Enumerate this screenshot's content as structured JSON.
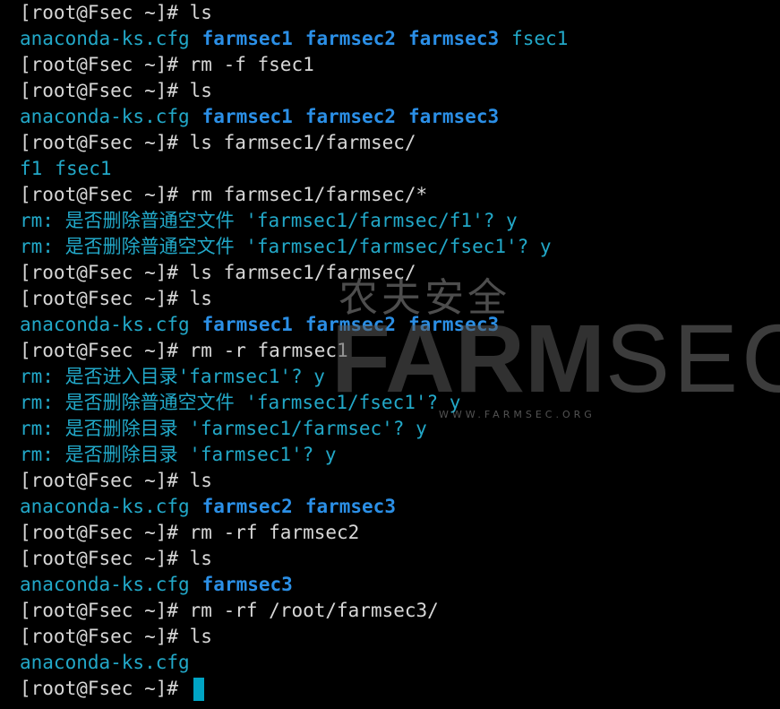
{
  "prompt": "[root@Fsec ~]# ",
  "lines": [
    {
      "type": "prompt",
      "cmd": "ls"
    },
    {
      "type": "listing",
      "items": [
        {
          "name": "anaconda-ks.cfg",
          "kind": "file"
        },
        {
          "name": "farmsec1",
          "kind": "dir"
        },
        {
          "name": "farmsec2",
          "kind": "dir"
        },
        {
          "name": "farmsec3",
          "kind": "dir"
        },
        {
          "name": "fsec1",
          "kind": "file"
        }
      ]
    },
    {
      "type": "prompt",
      "cmd": "rm -f fsec1"
    },
    {
      "type": "prompt",
      "cmd": "ls"
    },
    {
      "type": "listing",
      "items": [
        {
          "name": "anaconda-ks.cfg",
          "kind": "file"
        },
        {
          "name": "farmsec1",
          "kind": "dir"
        },
        {
          "name": "farmsec2",
          "kind": "dir"
        },
        {
          "name": "farmsec3",
          "kind": "dir"
        }
      ]
    },
    {
      "type": "prompt",
      "cmd": "ls farmsec1/farmsec/"
    },
    {
      "type": "listing",
      "items": [
        {
          "name": "f1",
          "kind": "file"
        },
        {
          "name": "fsec1",
          "kind": "file"
        }
      ]
    },
    {
      "type": "prompt",
      "cmd": "rm farmsec1/farmsec/*"
    },
    {
      "type": "output",
      "text": "rm: 是否删除普通空文件 'farmsec1/farmsec/f1'? y"
    },
    {
      "type": "output",
      "text": "rm: 是否删除普通空文件 'farmsec1/farmsec/fsec1'? y"
    },
    {
      "type": "prompt",
      "cmd": "ls farmsec1/farmsec/"
    },
    {
      "type": "prompt",
      "cmd": "ls"
    },
    {
      "type": "listing",
      "items": [
        {
          "name": "anaconda-ks.cfg",
          "kind": "file"
        },
        {
          "name": "farmsec1",
          "kind": "dir"
        },
        {
          "name": "farmsec2",
          "kind": "dir"
        },
        {
          "name": "farmsec3",
          "kind": "dir"
        }
      ]
    },
    {
      "type": "prompt",
      "cmd": "rm -r farmsec1"
    },
    {
      "type": "output",
      "text": "rm: 是否进入目录'farmsec1'? y"
    },
    {
      "type": "output",
      "text": "rm: 是否删除普通空文件 'farmsec1/fsec1'? y"
    },
    {
      "type": "output",
      "text": "rm: 是否删除目录 'farmsec1/farmsec'? y"
    },
    {
      "type": "output",
      "text": "rm: 是否删除目录 'farmsec1'? y"
    },
    {
      "type": "prompt",
      "cmd": "ls"
    },
    {
      "type": "listing",
      "items": [
        {
          "name": "anaconda-ks.cfg",
          "kind": "file"
        },
        {
          "name": "farmsec2",
          "kind": "dir"
        },
        {
          "name": "farmsec3",
          "kind": "dir"
        }
      ]
    },
    {
      "type": "prompt",
      "cmd": "rm -rf farmsec2"
    },
    {
      "type": "prompt",
      "cmd": "ls"
    },
    {
      "type": "listing",
      "items": [
        {
          "name": "anaconda-ks.cfg",
          "kind": "file"
        },
        {
          "name": "farmsec3",
          "kind": "dir"
        }
      ]
    },
    {
      "type": "prompt",
      "cmd": "rm -rf /root/farmsec3/"
    },
    {
      "type": "prompt",
      "cmd": "ls"
    },
    {
      "type": "listing",
      "items": [
        {
          "name": "anaconda-ks.cfg",
          "kind": "file"
        }
      ]
    },
    {
      "type": "prompt",
      "cmd": "",
      "cursor": true
    }
  ],
  "watermark": {
    "cn": "农夫安全",
    "logo_bold": "FARM",
    "logo_thin": "SEC",
    "url": "WWW.FARMSEC.ORG"
  },
  "colors": {
    "background": "#000000",
    "prompt": "#d7d7d7",
    "file": "#22a8c8",
    "dir": "#2b8fe6",
    "cursor": "#00a4c4"
  }
}
